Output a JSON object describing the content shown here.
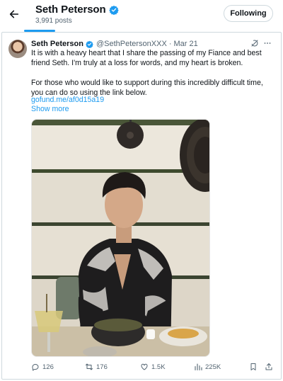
{
  "header": {
    "title": "Seth Peterson",
    "posts_count": "3,991 posts",
    "follow_label": "Following"
  },
  "tweet": {
    "author_name": "Seth Peterson",
    "handle": "@SethPetersonXXX",
    "separator": "·",
    "date": "Mar 21",
    "paragraph_1": "It is with a heavy heart that I share the passing of my Fiance and best friend Seth.  I'm truly at a loss for words, and my heart is broken.",
    "paragraph_2": "For those who would like to support during this incredibly difficult time, you can do so using the link below.",
    "link": "gofund.me/af0d15a19",
    "show_more": "Show more"
  },
  "actions": {
    "replies": "126",
    "reposts": "176",
    "likes": "1.5K",
    "views": "225K"
  },
  "icons": [
    "back-arrow-icon",
    "verified-badge-icon",
    "grok-icon",
    "more-icon",
    "reply-icon",
    "repost-icon",
    "like-icon",
    "views-icon",
    "bookmark-icon",
    "share-icon"
  ],
  "colors": {
    "accent": "#1d9bf0",
    "text": "#0f1419",
    "muted": "#536471",
    "border": "#cfd9de"
  }
}
